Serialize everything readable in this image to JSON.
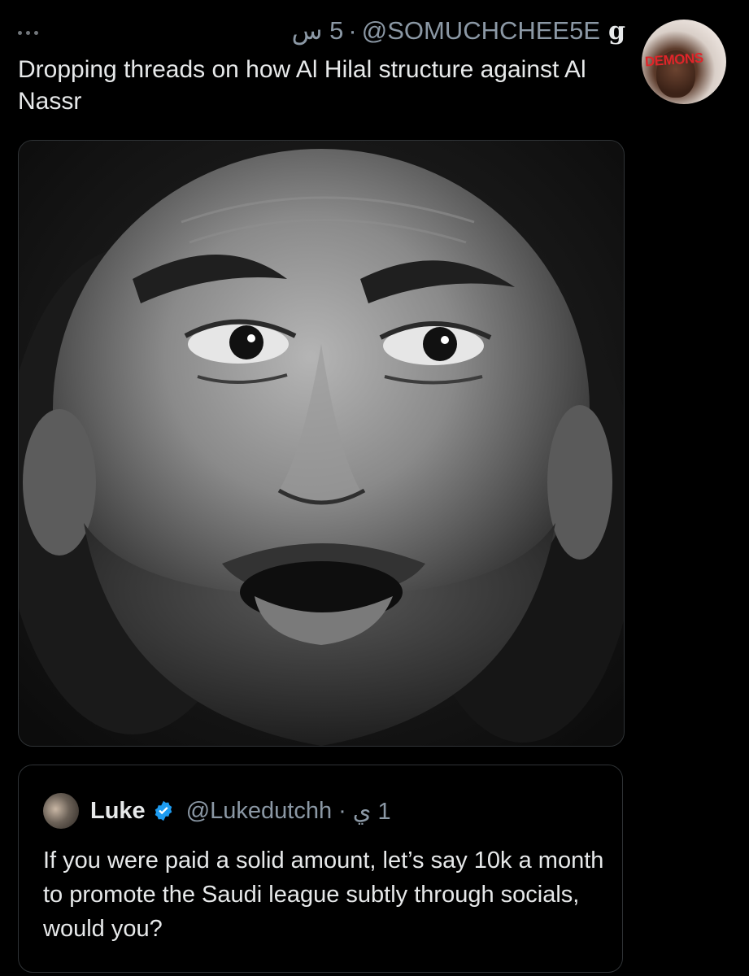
{
  "tweet": {
    "more_icon": "more-dots-icon",
    "time": "5 س",
    "separator": "·",
    "handle": "@SOMUCHCHEE5E",
    "display_name": "g",
    "avatar_text": "DEMONS",
    "text": "Dropping threads on how Al Hilal structure against Al Nassr",
    "media_icon": "photo-portrait-icon"
  },
  "quote": {
    "avatar_icon": "user-avatar-icon",
    "name": "Luke",
    "verified_icon": "verified-badge-icon",
    "handle": "@Lukedutchh",
    "separator": "·",
    "time": "1 ي",
    "text": "If you were paid a solid amount, let’s say 10k a month to promote the Saudi league subtly through socials, would you?"
  },
  "colors": {
    "background": "#000000",
    "text_primary": "#e7e9ea",
    "text_secondary": "#8b98a5",
    "border": "#2f3336",
    "verified": "#1d9bf0",
    "avatar_label": "#e0252a"
  }
}
